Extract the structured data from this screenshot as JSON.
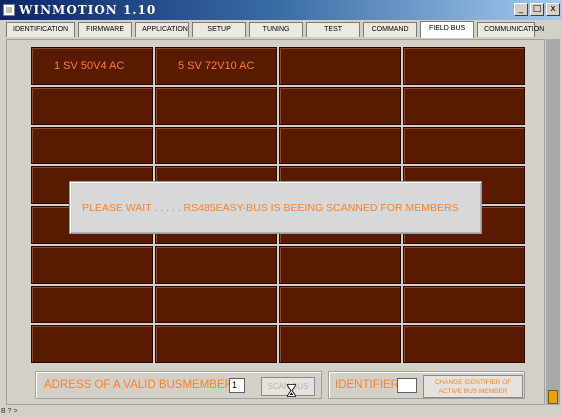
{
  "window": {
    "title": "WINMOTION 1.10",
    "controls": {
      "minimize": "_",
      "maximize": "□",
      "close": "x"
    }
  },
  "tabs": [
    {
      "label": "IDENTIFICATION",
      "active": false
    },
    {
      "label": "FIRMWARE",
      "active": false
    },
    {
      "label": "APPLICATION",
      "active": false
    },
    {
      "label": "SETUP",
      "active": false
    },
    {
      "label": "TUNING",
      "active": false
    },
    {
      "label": "TEST",
      "active": false
    },
    {
      "label": "COMMAND",
      "active": false
    },
    {
      "label": "FIELD BUS",
      "active": true
    },
    {
      "label": "COMMUNICATION",
      "active": false
    }
  ],
  "grid": {
    "cells": [
      [
        "1  SV 50V4 AC",
        "5  SV 72V10 AC",
        "",
        ""
      ],
      [
        "",
        "",
        "",
        ""
      ],
      [
        "",
        "",
        "",
        ""
      ],
      [
        "",
        "",
        "",
        ""
      ],
      [
        "",
        "",
        "",
        ""
      ],
      [
        "",
        "",
        "",
        ""
      ],
      [
        "",
        "",
        "",
        ""
      ],
      [
        "",
        "",
        "",
        ""
      ]
    ]
  },
  "dialog": {
    "message": "PLEASE WAIT . . . . . RS485EASY-BUS IS BEEING SCANNED FOR MEMBERS"
  },
  "bottom": {
    "address_label": "ADRESS OF A VALID BUSMEMBER",
    "address_value": "1",
    "scan_button": "SCAN BUS",
    "identifier_label": "IDENTIFIER",
    "identifier_value": "",
    "change_button": "CHANGE IDENTIFIER OF ACTIVE BUS MEMBER"
  },
  "status": {
    "text": "B ? >"
  },
  "colors": {
    "cell_bg": "#5a1a00",
    "accent_text": "#ff7f27",
    "window_bg": "#d4d0c8"
  },
  "icons": {
    "busy_cursor": "hourglass-icon",
    "app": "app-icon"
  }
}
